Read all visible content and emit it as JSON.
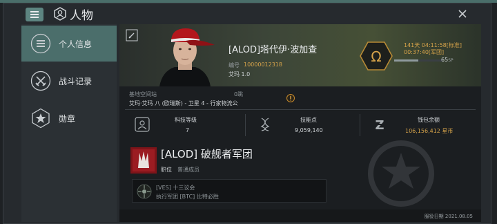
{
  "window": {
    "title": "人物",
    "menu_icon": "hamburger-icon",
    "title_icon": "character-sheet-icon",
    "close_icon": "close-icon"
  },
  "sidebar": {
    "items": [
      {
        "label": "个人信息",
        "icon": "list-icon",
        "active": true
      },
      {
        "label": "战斗记录",
        "icon": "crossed-swords-icon",
        "active": false
      },
      {
        "label": "勋章",
        "icon": "star-medal-icon",
        "active": false
      }
    ]
  },
  "character": {
    "name": "[ALOD]塔代伊·波加查",
    "id_label": "编号",
    "id": "10000012318",
    "security": "艾玛 1.0"
  },
  "omega": {
    "time_line1": "141天 04:11:58[标准]",
    "time_line2": "00:37:40[军团]",
    "progress": 0.5,
    "sp_value": "65",
    "sp_unit": "SP"
  },
  "location": {
    "label": "基地空间站",
    "jumps": "0跳",
    "value": "艾玛·艾玛 八 (欧瑞斯) - 卫星 4 - 行家物流公"
  },
  "stats": [
    {
      "label": "科技等级",
      "value": "7",
      "icon": "tech-level-icon"
    },
    {
      "label": "技能点",
      "value": "9,059,140",
      "icon": "dna-icon"
    },
    {
      "label": "钱包余额",
      "value": "106,156,412 星币",
      "icon": "isk-icon"
    }
  ],
  "corporation": {
    "name": "[ALOD] 破舰者军团",
    "role_label": "职位",
    "role": "普通成员"
  },
  "alliance": {
    "name": "[VES] 十三议会",
    "executor": "执行军团 [BTC] 比特必胜"
  },
  "footer": {
    "birth_date": "服役日期 2021.08.05"
  },
  "colors": {
    "accent": "#5d8581",
    "active_sidebar": "#4b6e6b",
    "gold": "#d6a34a"
  }
}
